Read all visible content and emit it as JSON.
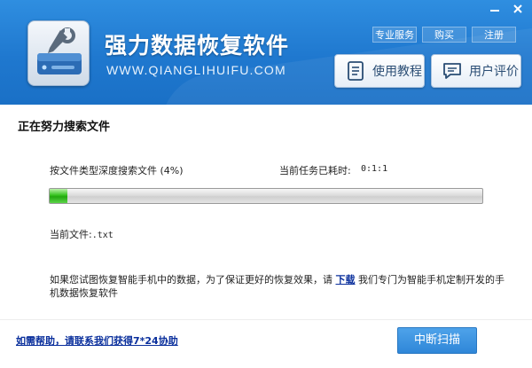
{
  "header": {
    "title": "强力数据恢复软件",
    "url": "WWW.QIANGLIHUIFU.COM",
    "top_links": [
      "专业服务",
      "购买",
      "注册"
    ],
    "buttons": {
      "tutorial": "使用教程",
      "review": "用户评价"
    }
  },
  "window_controls": {
    "minimize_icon": "minimize-icon",
    "close_icon": "close-icon"
  },
  "main": {
    "section_title": "正在努力搜索文件",
    "search_status": "按文件类型深度搜索文件 (4%)",
    "progress_percent": 4,
    "time_label": "当前任务已耗时:",
    "time_value": "0:1:1",
    "current_file_label": "当前文件:",
    "current_file_name": ".txt",
    "notice": {
      "before": "如果您试图恢复智能手机中的数据，为了保证更好的恢复效果，请",
      "link": "下载",
      "after": " 我们专门为智能手机定制开发的手机数据恢复软件"
    }
  },
  "footer": {
    "help_link": "如需帮助，请联系我们获得7*24协助",
    "stop_button": "中断扫描"
  },
  "colors": {
    "header_blue": "#1f78cf",
    "progress_green": "#22a80e",
    "link_blue": "#0a2f9c",
    "button_blue": "#2f87d8"
  }
}
